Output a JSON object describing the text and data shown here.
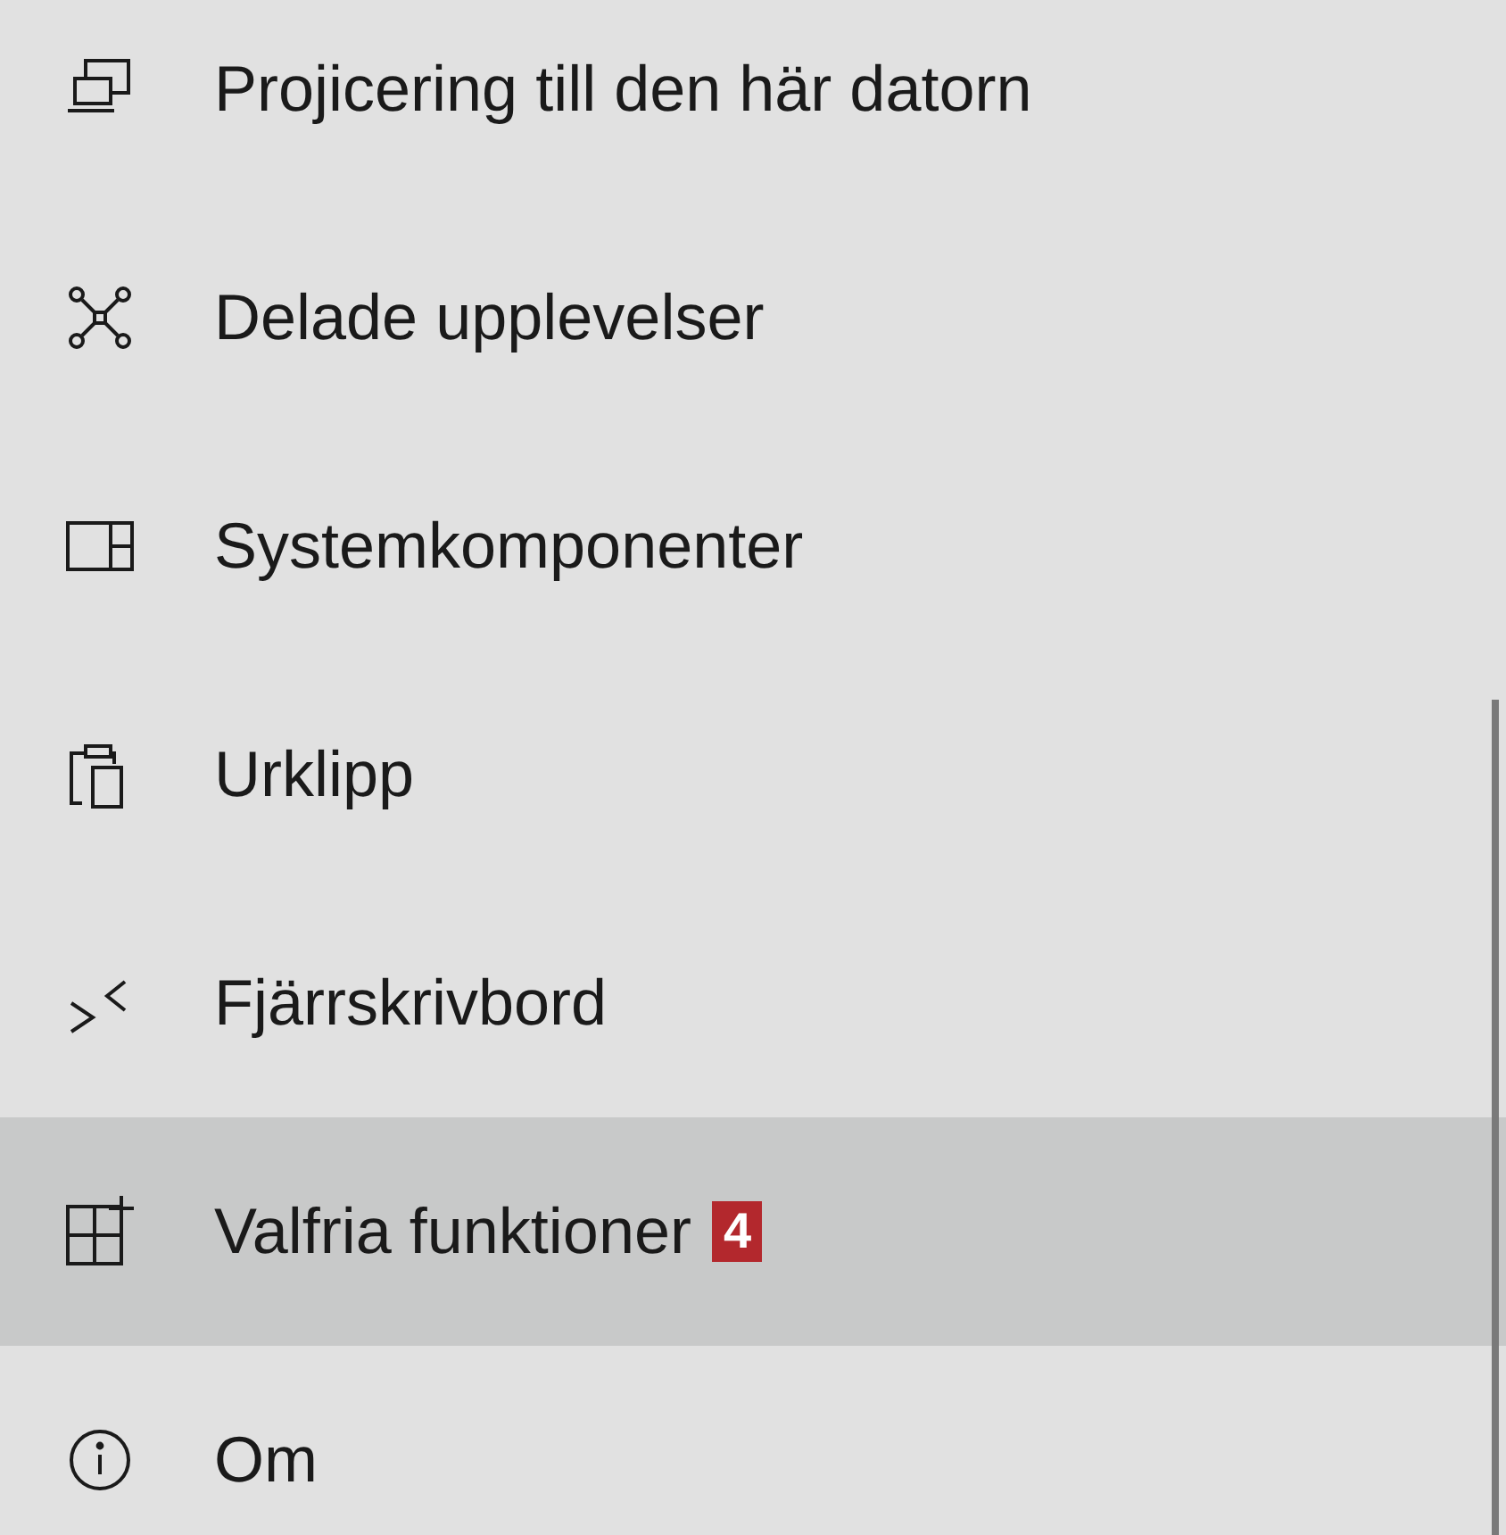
{
  "sidebar": {
    "items": [
      {
        "label": "Projicering till den här datorn",
        "selected": false
      },
      {
        "label": "Delade upplevelser",
        "selected": false
      },
      {
        "label": "Systemkomponenter",
        "selected": false
      },
      {
        "label": "Urklipp",
        "selected": false
      },
      {
        "label": "Fjärrskrivbord",
        "selected": false
      },
      {
        "label": "Valfria funktioner",
        "selected": true,
        "badge": "4"
      },
      {
        "label": "Om",
        "selected": false
      }
    ]
  }
}
